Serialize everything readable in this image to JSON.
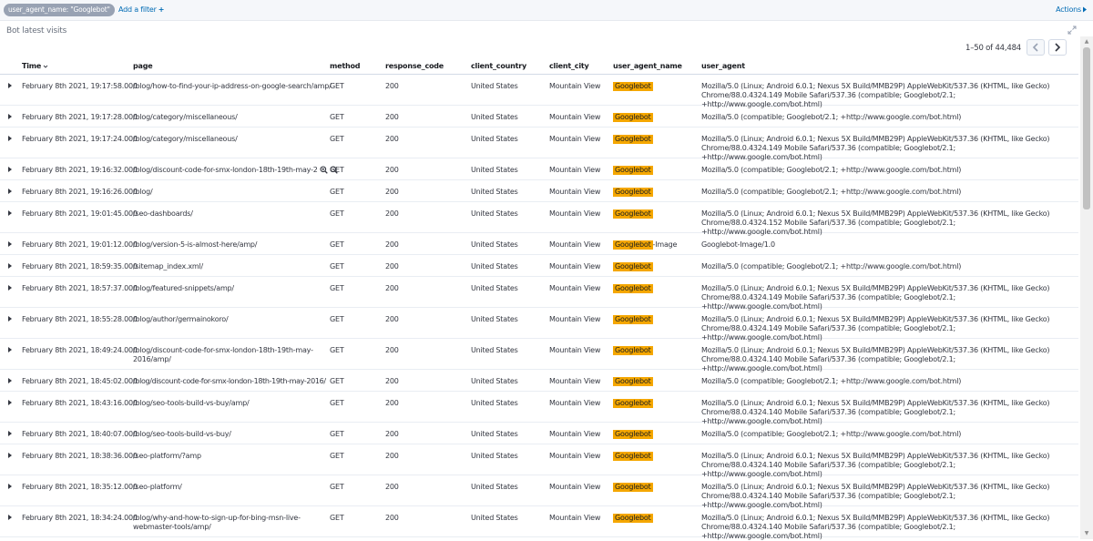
{
  "filter_bar": {
    "filter_pill": "user_agent_name: \"Googlebot\"",
    "add_filter": "Add a filter",
    "add_filter_plus": "+",
    "actions": "Actions"
  },
  "panel": {
    "title": "Bot latest visits",
    "pager": "1–50 of 44,484"
  },
  "columns": {
    "time": "Time",
    "page": "page",
    "method": "method",
    "response_code": "response_code",
    "client_country": "client_country",
    "client_city": "client_city",
    "user_agent_name": "user_agent_name",
    "user_agent": "user_agent"
  },
  "rows": [
    {
      "time": "February 8th 2021, 19:17:58.000",
      "page": "/blog/how-to-find-your-ip-address-on-google-search/amp/",
      "method": "GET",
      "code": "200",
      "country": "United States",
      "city": "Mountain View",
      "uan": "Googlebot",
      "uan_suffix": "",
      "ua": "Mozilla/5.0 (Linux; Android 6.0.1; Nexus 5X Build/MMB29P) AppleWebKit/537.36 (KHTML, like Gecko) Chrome/88.0.4324.149 Mobile Safari/537.36 (compatible; Googlebot/2.1; +http://www.google.com/bot.html)"
    },
    {
      "time": "February 8th 2021, 19:17:28.000",
      "page": "/blog/category/miscellaneous/",
      "method": "GET",
      "code": "200",
      "country": "United States",
      "city": "Mountain View",
      "uan": "Googlebot",
      "uan_suffix": "",
      "ua": "Mozilla/5.0 (compatible; Googlebot/2.1; +http://www.google.com/bot.html)"
    },
    {
      "time": "February 8th 2021, 19:17:24.000",
      "page": "/blog/category/miscellaneous/",
      "method": "GET",
      "code": "200",
      "country": "United States",
      "city": "Mountain View",
      "uan": "Googlebot",
      "uan_suffix": "",
      "ua": "Mozilla/5.0 (Linux; Android 6.0.1; Nexus 5X Build/MMB29P) AppleWebKit/537.36 (KHTML, like Gecko) Chrome/88.0.4324.149 Mobile Safari/537.36 (compatible; Googlebot/2.1; +http://www.google.com/bot.html)"
    },
    {
      "time": "February 8th 2021, 19:16:32.000",
      "page": "/blog/discount-code-for-smx-london-18th-19th-may-2",
      "method": "GET",
      "code": "200",
      "country": "United States",
      "city": "Mountain View",
      "uan": "Googlebot",
      "uan_suffix": "",
      "ua": "Mozilla/5.0 (compatible; Googlebot/2.1; +http://www.google.com/bot.html)"
    },
    {
      "time": "February 8th 2021, 19:16:26.000",
      "page": "/blog/",
      "method": "GET",
      "code": "200",
      "country": "United States",
      "city": "Mountain View",
      "uan": "Googlebot",
      "uan_suffix": "",
      "ua": "Mozilla/5.0 (compatible; Googlebot/2.1; +http://www.google.com/bot.html)"
    },
    {
      "time": "February 8th 2021, 19:01:45.000",
      "page": "/seo-dashboards/",
      "method": "GET",
      "code": "200",
      "country": "United States",
      "city": "Mountain View",
      "uan": "Googlebot",
      "uan_suffix": "",
      "ua": "Mozilla/5.0 (Linux; Android 6.0.1; Nexus 5X Build/MMB29P) AppleWebKit/537.36 (KHTML, like Gecko) Chrome/88.0.4324.152 Mobile Safari/537.36 (compatible; Googlebot/2.1; +http://www.google.com/bot.html)"
    },
    {
      "time": "February 8th 2021, 19:01:12.000",
      "page": "/blog/version-5-is-almost-here/amp/",
      "method": "GET",
      "code": "200",
      "country": "United States",
      "city": "Mountain View",
      "uan": "Googlebot",
      "uan_suffix": "-Image",
      "ua": "Googlebot-Image/1.0"
    },
    {
      "time": "February 8th 2021, 18:59:35.000",
      "page": "/sitemap_index.xml/",
      "method": "GET",
      "code": "200",
      "country": "United States",
      "city": "Mountain View",
      "uan": "Googlebot",
      "uan_suffix": "",
      "ua": "Mozilla/5.0 (compatible; Googlebot/2.1; +http://www.google.com/bot.html)"
    },
    {
      "time": "February 8th 2021, 18:57:37.000",
      "page": "/blog/featured-snippets/amp/",
      "method": "GET",
      "code": "200",
      "country": "United States",
      "city": "Mountain View",
      "uan": "Googlebot",
      "uan_suffix": "",
      "ua": "Mozilla/5.0 (Linux; Android 6.0.1; Nexus 5X Build/MMB29P) AppleWebKit/537.36 (KHTML, like Gecko) Chrome/88.0.4324.149 Mobile Safari/537.36 (compatible; Googlebot/2.1; +http://www.google.com/bot.html)"
    },
    {
      "time": "February 8th 2021, 18:55:28.000",
      "page": "/blog/author/germainokoro/",
      "method": "GET",
      "code": "200",
      "country": "United States",
      "city": "Mountain View",
      "uan": "Googlebot",
      "uan_suffix": "",
      "ua": "Mozilla/5.0 (Linux; Android 6.0.1; Nexus 5X Build/MMB29P) AppleWebKit/537.36 (KHTML, like Gecko) Chrome/88.0.4324.149 Mobile Safari/537.36 (compatible; Googlebot/2.1; +http://www.google.com/bot.html)"
    },
    {
      "time": "February 8th 2021, 18:49:24.000",
      "page": "/blog/discount-code-for-smx-london-18th-19th-may-2016/amp/",
      "method": "GET",
      "code": "200",
      "country": "United States",
      "city": "Mountain View",
      "uan": "Googlebot",
      "uan_suffix": "",
      "ua": "Mozilla/5.0 (Linux; Android 6.0.1; Nexus 5X Build/MMB29P) AppleWebKit/537.36 (KHTML, like Gecko) Chrome/88.0.4324.140 Mobile Safari/537.36 (compatible; Googlebot/2.1; +http://www.google.com/bot.html)"
    },
    {
      "time": "February 8th 2021, 18:45:02.000",
      "page": "/blog/discount-code-for-smx-london-18th-19th-may-2016/",
      "method": "GET",
      "code": "200",
      "country": "United States",
      "city": "Mountain View",
      "uan": "Googlebot",
      "uan_suffix": "",
      "ua": "Mozilla/5.0 (compatible; Googlebot/2.1; +http://www.google.com/bot.html)"
    },
    {
      "time": "February 8th 2021, 18:43:16.000",
      "page": "/blog/seo-tools-build-vs-buy/amp/",
      "method": "GET",
      "code": "200",
      "country": "United States",
      "city": "Mountain View",
      "uan": "Googlebot",
      "uan_suffix": "",
      "ua": "Mozilla/5.0 (Linux; Android 6.0.1; Nexus 5X Build/MMB29P) AppleWebKit/537.36 (KHTML, like Gecko) Chrome/88.0.4324.140 Mobile Safari/537.36 (compatible; Googlebot/2.1; +http://www.google.com/bot.html)"
    },
    {
      "time": "February 8th 2021, 18:40:07.000",
      "page": "/blog/seo-tools-build-vs-buy/",
      "method": "GET",
      "code": "200",
      "country": "United States",
      "city": "Mountain View",
      "uan": "Googlebot",
      "uan_suffix": "",
      "ua": "Mozilla/5.0 (compatible; Googlebot/2.1; +http://www.google.com/bot.html)"
    },
    {
      "time": "February 8th 2021, 18:38:36.000",
      "page": "/seo-platform/?amp",
      "method": "GET",
      "code": "200",
      "country": "United States",
      "city": "Mountain View",
      "uan": "Googlebot",
      "uan_suffix": "",
      "ua": "Mozilla/5.0 (Linux; Android 6.0.1; Nexus 5X Build/MMB29P) AppleWebKit/537.36 (KHTML, like Gecko) Chrome/88.0.4324.140 Mobile Safari/537.36 (compatible; Googlebot/2.1; +http://www.google.com/bot.html)"
    },
    {
      "time": "February 8th 2021, 18:35:12.000",
      "page": "/seo-platform/",
      "method": "GET",
      "code": "200",
      "country": "United States",
      "city": "Mountain View",
      "uan": "Googlebot",
      "uan_suffix": "",
      "ua": "Mozilla/5.0 (Linux; Android 6.0.1; Nexus 5X Build/MMB29P) AppleWebKit/537.36 (KHTML, like Gecko) Chrome/88.0.4324.140 Mobile Safari/537.36 (compatible; Googlebot/2.1; +http://www.google.com/bot.html)"
    },
    {
      "time": "February 8th 2021, 18:34:24.000",
      "page": "/blog/why-and-how-to-sign-up-for-bing-msn-live-webmaster-tools/amp/",
      "method": "GET",
      "code": "200",
      "country": "United States",
      "city": "Mountain View",
      "uan": "Googlebot",
      "uan_suffix": "",
      "ua": "Mozilla/5.0 (Linux; Android 6.0.1; Nexus 5X Build/MMB29P) AppleWebKit/537.36 (KHTML, like Gecko) Chrome/88.0.4324.140 Mobile Safari/537.36 (compatible; Googlebot/2.1; +http://www.google.com/bot.html)"
    }
  ]
}
